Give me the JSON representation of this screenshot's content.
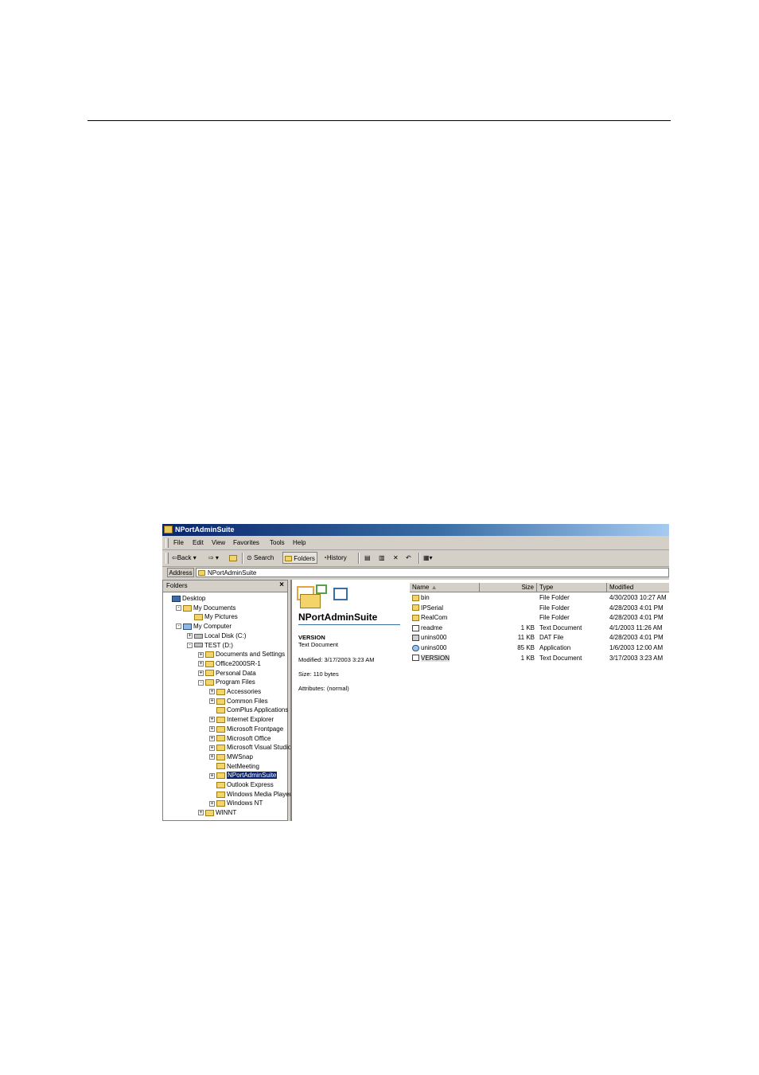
{
  "window": {
    "title": "NPortAdminSuite"
  },
  "menu": [
    "File",
    "Edit",
    "View",
    "Favorites",
    "Tools",
    "Help"
  ],
  "toolbar": {
    "back": "Back",
    "search": "Search",
    "folders": "Folders",
    "history": "History"
  },
  "address": {
    "label": "Address",
    "value": "NPortAdminSuite"
  },
  "folders_pane": {
    "title": "Folders",
    "close": "×",
    "items": [
      {
        "label": "Desktop",
        "level": 0,
        "icon": "desktop-icon",
        "expander": ""
      },
      {
        "label": "My Documents",
        "level": 1,
        "icon": "folder-icon",
        "expander": "-"
      },
      {
        "label": "My Pictures",
        "level": 2,
        "icon": "folder-icon",
        "expander": ""
      },
      {
        "label": "My Computer",
        "level": 1,
        "icon": "computer-icon",
        "expander": "-"
      },
      {
        "label": "Local Disk (C:)",
        "level": 2,
        "icon": "drive-icon",
        "expander": "+"
      },
      {
        "label": "TEST (D:)",
        "level": 2,
        "icon": "drive-icon",
        "expander": "-"
      },
      {
        "label": "Documents and Settings",
        "level": 3,
        "icon": "folder-icon",
        "expander": "+"
      },
      {
        "label": "Office2000SR-1",
        "level": 3,
        "icon": "folder-icon",
        "expander": "+"
      },
      {
        "label": "Personal Data",
        "level": 3,
        "icon": "folder-icon",
        "expander": "+"
      },
      {
        "label": "Program Files",
        "level": 3,
        "icon": "folder-icon",
        "expander": "-"
      },
      {
        "label": "Accessories",
        "level": 4,
        "icon": "folder-icon",
        "expander": "+"
      },
      {
        "label": "Common Files",
        "level": 4,
        "icon": "folder-icon",
        "expander": "+"
      },
      {
        "label": "ComPlus Applications",
        "level": 4,
        "icon": "folder-icon",
        "expander": ""
      },
      {
        "label": "Internet Explorer",
        "level": 4,
        "icon": "folder-icon",
        "expander": "+"
      },
      {
        "label": "Microsoft Frontpage",
        "level": 4,
        "icon": "folder-icon",
        "expander": "+"
      },
      {
        "label": "Microsoft Office",
        "level": 4,
        "icon": "folder-icon",
        "expander": "+"
      },
      {
        "label": "Microsoft Visual Studio",
        "level": 4,
        "icon": "folder-icon",
        "expander": "+"
      },
      {
        "label": "MWSnap",
        "level": 4,
        "icon": "folder-icon",
        "expander": "+"
      },
      {
        "label": "NetMeeting",
        "level": 4,
        "icon": "folder-icon",
        "expander": ""
      },
      {
        "label": "NPortAdminSuite",
        "level": 4,
        "icon": "folder-icon",
        "expander": "+",
        "selected": true
      },
      {
        "label": "Outlook Express",
        "level": 4,
        "icon": "folder-icon",
        "expander": ""
      },
      {
        "label": "Windows Media Player",
        "level": 4,
        "icon": "folder-icon",
        "expander": ""
      },
      {
        "label": "Windows NT",
        "level": 4,
        "icon": "folder-icon",
        "expander": "+"
      },
      {
        "label": "WINNT",
        "level": 3,
        "icon": "folder-icon",
        "expander": "+"
      }
    ]
  },
  "details": {
    "folder_title": "NPortAdminSuite",
    "file_name": "VERSION",
    "file_type": "Text Document",
    "modified": "Modified: 3/17/2003 3:23 AM",
    "size": "Size: 110 bytes",
    "attributes": "Attributes: (normal)"
  },
  "file_list": {
    "columns": [
      "Name",
      "Size",
      "Type",
      "Modified"
    ],
    "rows": [
      {
        "name": "bin",
        "size": "",
        "type": "File Folder",
        "modified": "4/30/2003 10:27 AM",
        "icon": "folder-icon"
      },
      {
        "name": "IPSerial",
        "size": "",
        "type": "File Folder",
        "modified": "4/28/2003 4:01 PM",
        "icon": "folder-icon"
      },
      {
        "name": "RealCom",
        "size": "",
        "type": "File Folder",
        "modified": "4/28/2003 4:01 PM",
        "icon": "folder-icon"
      },
      {
        "name": "readme",
        "size": "1 KB",
        "type": "Text Document",
        "modified": "4/1/2003 11:26 AM",
        "icon": "text-document-icon"
      },
      {
        "name": "unins000",
        "size": "11 KB",
        "type": "DAT File",
        "modified": "4/28/2003 4:01 PM",
        "icon": "dat-file-icon"
      },
      {
        "name": "unins000",
        "size": "85 KB",
        "type": "Application",
        "modified": "1/6/2003 12:00 AM",
        "icon": "application-icon"
      },
      {
        "name": "VERSION",
        "size": "1 KB",
        "type": "Text Document",
        "modified": "3/17/2003 3:23 AM",
        "icon": "text-document-icon",
        "selected": true
      }
    ]
  }
}
